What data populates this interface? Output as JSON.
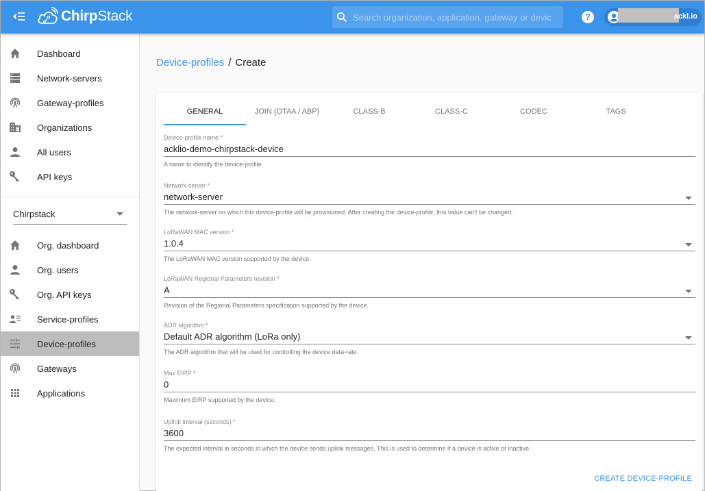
{
  "header": {
    "menu_icon": "menu-open-icon",
    "brand_bold": "Chirp",
    "brand_light": "Stack",
    "search_placeholder": "Search organization, application, gateway or device",
    "help_icon": "help-icon",
    "user_suffix": "ackl.io"
  },
  "sidebar": {
    "admin_items": [
      {
        "label": "Dashboard",
        "icon": "home-icon"
      },
      {
        "label": "Network-servers",
        "icon": "server-icon"
      },
      {
        "label": "Gateway-profiles",
        "icon": "antenna-icon"
      },
      {
        "label": "Organizations",
        "icon": "building-icon"
      },
      {
        "label": "All users",
        "icon": "person-icon"
      },
      {
        "label": "API keys",
        "icon": "key-icon"
      }
    ],
    "org_selector": "Chirpstack",
    "org_items": [
      {
        "label": "Org. dashboard",
        "icon": "home-icon"
      },
      {
        "label": "Org. users",
        "icon": "person-icon"
      },
      {
        "label": "Org. API keys",
        "icon": "key-icon"
      },
      {
        "label": "Service-profiles",
        "icon": "account-details-icon"
      },
      {
        "label": "Device-profiles",
        "icon": "tune-icon",
        "active": true
      },
      {
        "label": "Gateways",
        "icon": "antenna-icon"
      },
      {
        "label": "Applications",
        "icon": "apps-grid-icon"
      }
    ]
  },
  "breadcrumb": {
    "parent": "Device-profiles",
    "separator": "/",
    "current": "Create"
  },
  "tabs": [
    {
      "label": "General",
      "active": true
    },
    {
      "label": "Join (OTAA / ABP)"
    },
    {
      "label": "Class-B"
    },
    {
      "label": "Class-C"
    },
    {
      "label": "Codec"
    },
    {
      "label": "Tags"
    }
  ],
  "form": {
    "fields": [
      {
        "label": "Device-profile name *",
        "value": "acklio-demo-chirpstack-device",
        "help": "A name to identify the device-profile.",
        "type": "text"
      },
      {
        "label": "Network-server *",
        "value": "network-server",
        "help": "The network-server on which this device-profile will be provisioned. After creating the device-profile, this value can't be changed.",
        "type": "select"
      },
      {
        "label": "LoRaWAN MAC version *",
        "value": "1.0.4",
        "help": "The LoRaWAN MAC version supported by the device.",
        "type": "select"
      },
      {
        "label": "LoRaWAN Regional Parameters revision *",
        "value": "A",
        "help": "Revision of the Regional Parameters specification supported by the device.",
        "type": "select"
      },
      {
        "label": "ADR algorithm *",
        "value": "Default ADR algorithm (LoRa only)",
        "help": "The ADR algorithm that will be used for controlling the device data-rate.",
        "type": "select"
      },
      {
        "label": "Max EIRP *",
        "value": "0",
        "help": "Maximum EIRP supported by the device.",
        "type": "text"
      },
      {
        "label": "Uplink interval (seconds) *",
        "value": "3600",
        "help": "The expected interval in seconds in which the device sends uplink messages. This is used to determine if a device is active or inactive.",
        "type": "text"
      }
    ],
    "submit_label": "Create device-profile"
  },
  "colors": {
    "primary": "#3b93ea",
    "active_nav_bg": "#bdbdbd"
  }
}
